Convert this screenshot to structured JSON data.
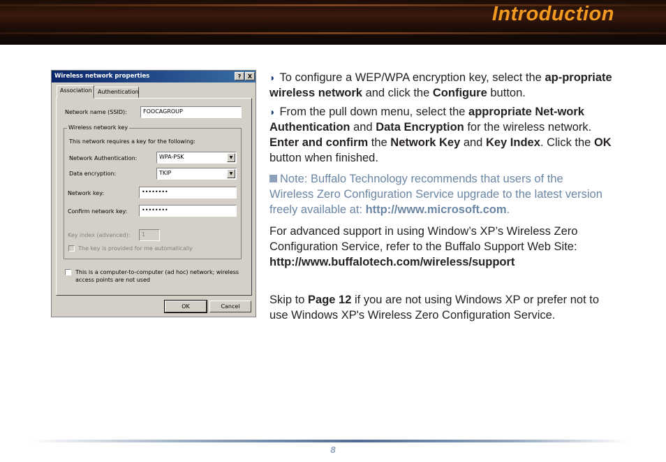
{
  "header": {
    "title": "Introduction"
  },
  "dialog": {
    "title": "Wireless network properties",
    "help_btn": "?",
    "close_btn": "X",
    "tabs": [
      "Association",
      "Authentication"
    ],
    "network_name_label": "Network name (SSID):",
    "network_name_value": "FOOCAGROUP",
    "group_label": "Wireless network key",
    "requires_text": "This network requires a key for the following:",
    "auth_label": "Network Authentication:",
    "auth_value": "WPA-PSK",
    "enc_label": "Data encryption:",
    "enc_value": "TKIP",
    "key_label": "Network key:",
    "key_value": "••••••••",
    "confirm_label": "Confirm network key:",
    "confirm_value": "••••••••",
    "key_index_label": "Key index (advanced):",
    "key_index_value": "1",
    "auto_key_label": "The key is provided for me automatically",
    "adhoc_line1": "This is a computer-to-computer (ad hoc) network; wireless",
    "adhoc_line2": "access points are not used",
    "ok": "OK",
    "cancel": "Cancel"
  },
  "content": {
    "p1_a": "To configure a WEP/WPA encryption key, select the ",
    "p1_b": "ap-propriate wireless network",
    "p1_c": " and click the ",
    "p1_d": "Configure",
    "p1_e": " button.",
    "p2_a": "From the pull down menu, select the ",
    "p2_b": "appropriate Net-work Authentication",
    "p2_c": " and ",
    "p2_d": "Data Encryption",
    "p2_e": " for the wireless network.  ",
    "p2_f": "Enter and confirm",
    "p2_g": " the ",
    "p2_h": "Network Key",
    "p2_i": " and ",
    "p2_j": "Key Index",
    "p2_k": ".  Click the ",
    "p2_l": "OK",
    "p2_m": " button when finished.",
    "note_a": "Note: Buffalo Technology recommends that users of the Wireless Zero Configuration Service upgrade to the latest version freely available at: ",
    "note_b": "http://www.microsoft.com",
    "note_c": ".",
    "p3_a": "For advanced support in using Window’s XP’s Wireless Zero Configuration Service, refer to the Buffalo Support Web Site: ",
    "p3_b": "http://www.buffalotech.com/wireless/support",
    "p4_a": "Skip to ",
    "p4_b": "Page 12",
    "p4_c": " if you are not using Windows XP or prefer not to use Windows XP's Wireless Zero Configuration Service."
  },
  "footer": {
    "page_number": "8"
  }
}
